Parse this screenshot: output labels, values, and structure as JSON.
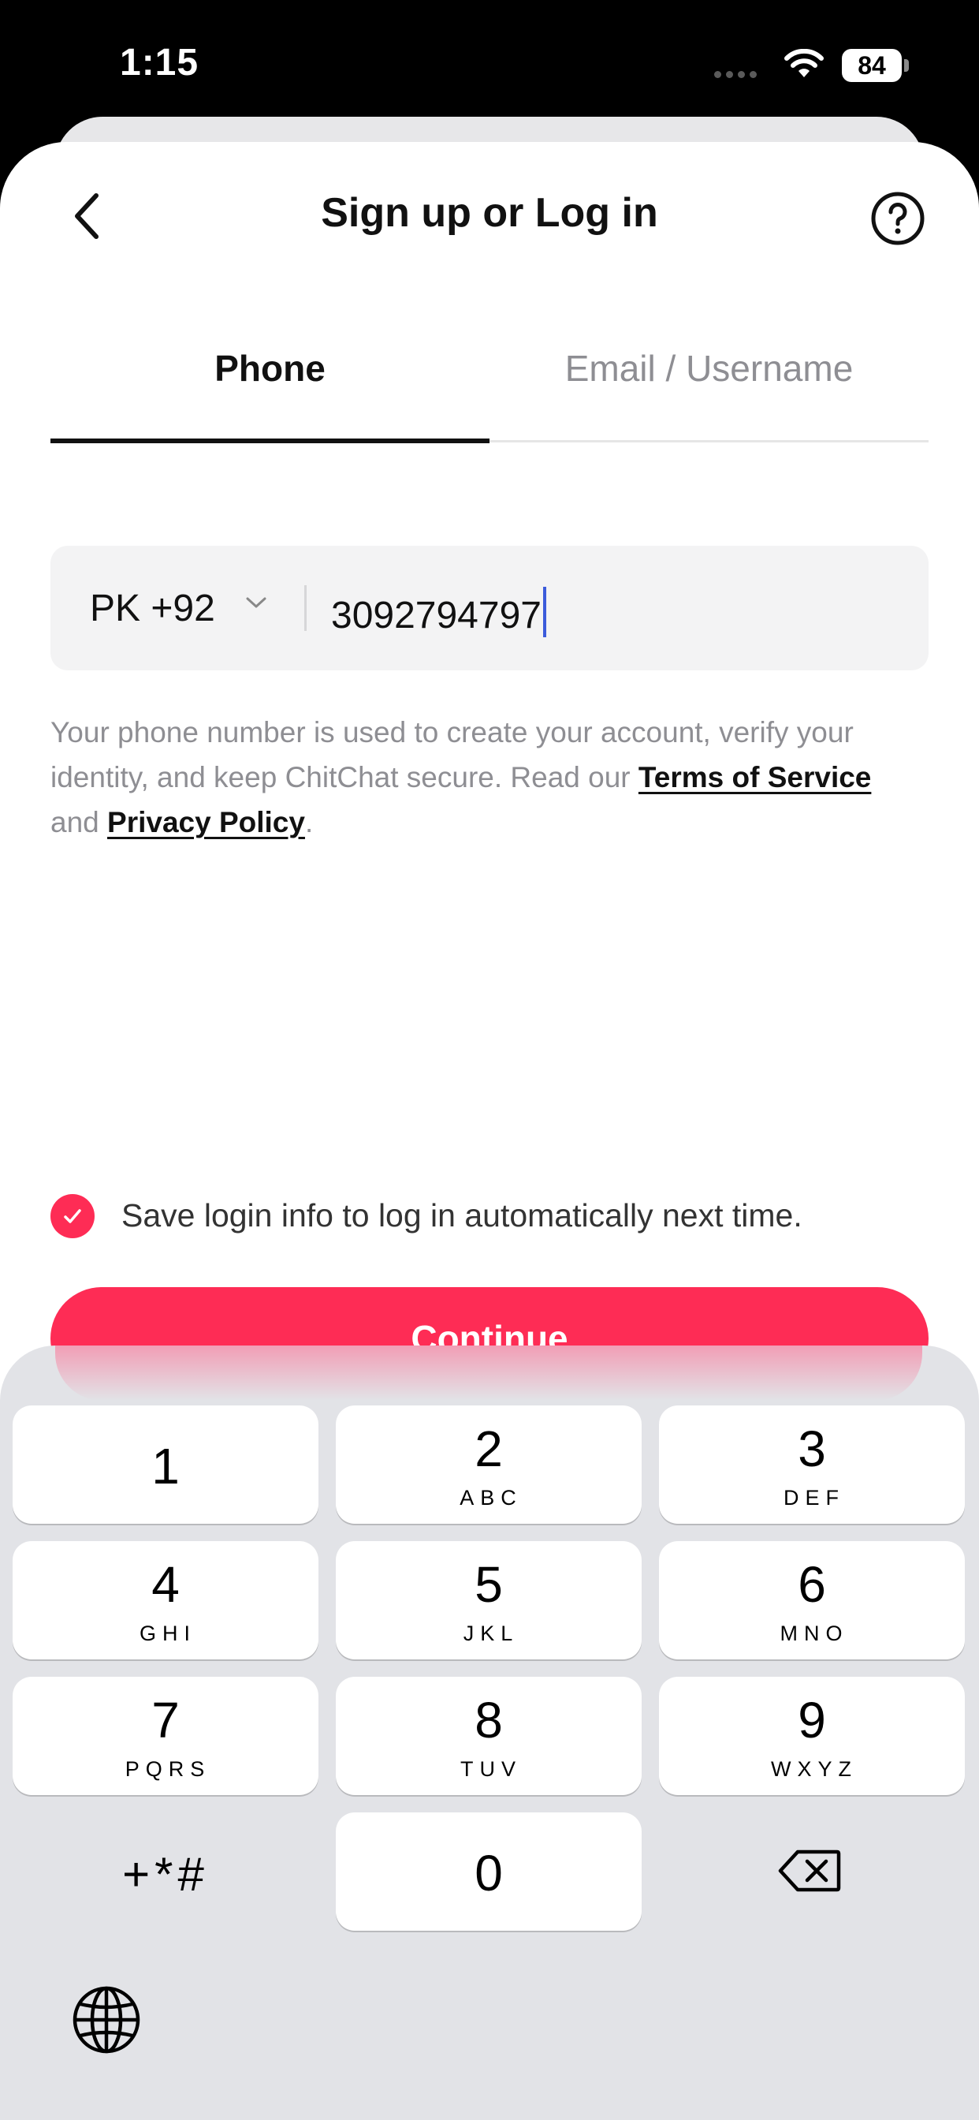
{
  "status_bar": {
    "time": "1:15",
    "battery": "84"
  },
  "nav": {
    "title": "Sign up or Log in"
  },
  "tabs": [
    {
      "label": "Phone"
    },
    {
      "label": "Email / Username"
    }
  ],
  "phone_field": {
    "country": "PK +92",
    "value": "3092794797"
  },
  "disclaimer": {
    "text_1": "Your phone number is used to create your account, verify your identity, and keep ChitChat secure. Read our ",
    "terms": "Terms of Service",
    "text_2": " and ",
    "privacy": "Privacy Policy",
    "text_3": "."
  },
  "save_login": {
    "label": "Save login info to log in automatically next time.",
    "checked": true
  },
  "continue_button": {
    "label": "Continue"
  },
  "keypad": {
    "keys": [
      {
        "digit": "1",
        "letters": ""
      },
      {
        "digit": "2",
        "letters": "ABC"
      },
      {
        "digit": "3",
        "letters": "DEF"
      },
      {
        "digit": "4",
        "letters": "GHI"
      },
      {
        "digit": "5",
        "letters": "JKL"
      },
      {
        "digit": "6",
        "letters": "MNO"
      },
      {
        "digit": "7",
        "letters": "PQRS"
      },
      {
        "digit": "8",
        "letters": "TUV"
      },
      {
        "digit": "9",
        "letters": "WXYZ"
      },
      {
        "digit": "0",
        "letters": ""
      }
    ],
    "symbols": "+*#"
  },
  "colors": {
    "accent": "#fe2c55",
    "keypad_bg": "#e2e3e7",
    "caret": "#3b5bdb"
  }
}
